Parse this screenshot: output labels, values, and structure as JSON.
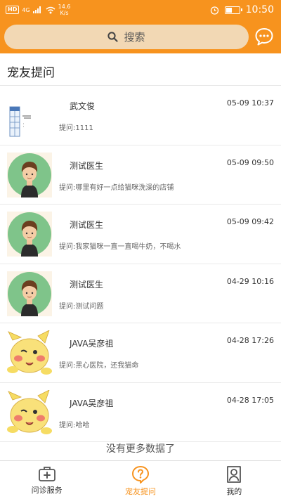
{
  "status_bar": {
    "signal_badge": "HD",
    "network": "4G",
    "speed_value": "14.6",
    "speed_unit": "K/s",
    "time": "10:50",
    "battery_level_percent": 45
  },
  "search": {
    "placeholder": "搜索"
  },
  "section": {
    "title": "宠友提问"
  },
  "questions": [
    {
      "name": "武文俊",
      "time": "05-09 10:37",
      "question": "提问:1111",
      "avatar": "sketch"
    },
    {
      "name": "测试医生",
      "time": "05-09 09:50",
      "question": "提问:哪里有好一点给猫咪洗澡的店铺",
      "avatar": "boy"
    },
    {
      "name": "测试医生",
      "time": "05-09 09:42",
      "question": "提问:我家猫咪一直一直喝牛奶，不喝水",
      "avatar": "boy"
    },
    {
      "name": "测试医生",
      "time": "04-29 10:16",
      "question": "提问:测试问题",
      "avatar": "boy"
    },
    {
      "name": "JAVA吴彦祖",
      "time": "04-28 17:26",
      "question": "提问:黑心医院，还我猫命",
      "avatar": "pikachu"
    },
    {
      "name": "JAVA吴彦祖",
      "time": "04-28 17:05",
      "question": "提问:哈哈",
      "avatar": "pikachu"
    }
  ],
  "footer": {
    "no_more": "没有更多数据了"
  },
  "tabs": [
    {
      "label": "问诊服务",
      "icon": "medical-kit-icon",
      "active": false
    },
    {
      "label": "宠友提问",
      "icon": "question-bubble-icon",
      "active": true
    },
    {
      "label": "我的",
      "icon": "user-icon",
      "active": false
    }
  ],
  "colors": {
    "accent": "#f7931e",
    "search_bg": "#f2d8b4"
  }
}
